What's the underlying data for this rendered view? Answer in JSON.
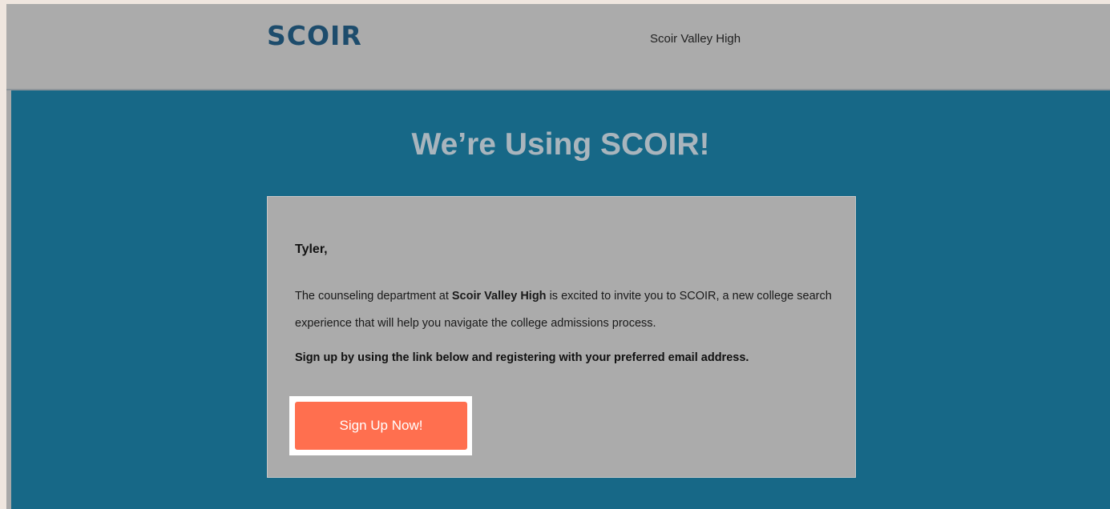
{
  "header": {
    "logo_text": "SCOIR",
    "school_name": "Scoir Valley High"
  },
  "hero": {
    "title": "We’re Using SCOIR!"
  },
  "card": {
    "greeting": "Tyler,",
    "body_prefix": "The counseling department at ",
    "body_school": "Scoir Valley High",
    "body_suffix": " is excited to invite you to SCOIR, a new college search experience that will help you navigate the college admissions process.",
    "cta_text": "Sign up by using the link below and registering with your preferred email address.",
    "signup_label": "Sign Up Now!"
  },
  "colors": {
    "brand_blue": "#1d4c6c",
    "hero_teal": "#176887",
    "button_orange": "#ff6f4f"
  }
}
